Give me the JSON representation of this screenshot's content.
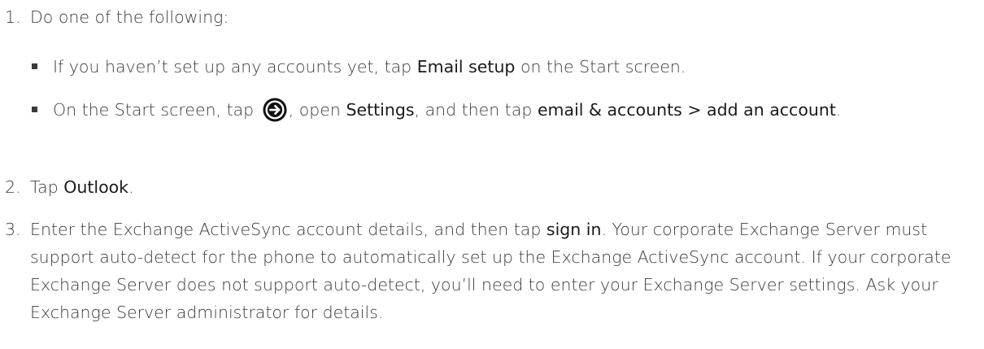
{
  "steps": [
    {
      "number": "1.",
      "text": "Do one of the following:",
      "bullets": [
        {
          "t1": "If you haven’t set up any accounts yet, tap ",
          "ui1": "Email setup",
          "t2": " on the Start screen."
        },
        {
          "t1": "On the Start screen, tap ",
          "icon": "right-arrow-circle-icon",
          "t2": ", open ",
          "ui1": "Settings",
          "t3": ", and then tap ",
          "ui2": "email & accounts > add an account",
          "t4": "."
        }
      ]
    },
    {
      "number": "2.",
      "t1": "Tap ",
      "ui1": "Outlook",
      "t2": "."
    },
    {
      "number": "3.",
      "t1": "Enter the Exchange ActiveSync account details, and then tap ",
      "ui1": "sign in",
      "t2": ". Your corporate Exchange Server must support auto-detect for the phone to automatically set up the Exchange ActiveSync account. If your corporate Exchange Server does not support auto-detect, you’ll need to enter your Exchange Server settings. Ask your Exchange Server administrator for details."
    }
  ]
}
